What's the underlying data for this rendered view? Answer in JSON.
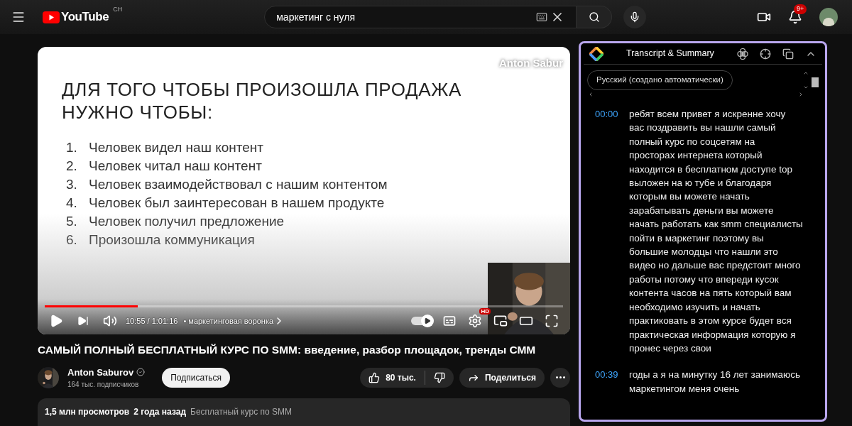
{
  "header": {
    "logo": "YouTube",
    "country": "CH",
    "search": {
      "value": "маркетинг с нуля"
    },
    "notifications": "9+"
  },
  "video": {
    "watermark": "Anton Sabur",
    "slide": {
      "title": "ДЛЯ ТОГО ЧТОБЫ ПРОИЗОШЛА ПРОДАЖА НУЖНО ЧТОБЫ:",
      "items": [
        {
          "number": "1.",
          "text": "Человек видел наш контент"
        },
        {
          "number": "2.",
          "text": "Человек читал наш контент"
        },
        {
          "number": "3.",
          "text": "Человек взаимодействовал с нашим контентом"
        },
        {
          "number": "4.",
          "text": "Человек был заинтересован в нашем продукте"
        },
        {
          "number": "5.",
          "text": "Человек получил предложение"
        },
        {
          "number": "6.",
          "text": "Произошла коммуникация"
        }
      ]
    },
    "progress": {
      "level": 0.18
    },
    "time": "10:55 / 1:01:16",
    "chapter": "• маркетинговая воронка",
    "autoplay": {
      "on": true
    },
    "quality_badge": "HD"
  },
  "title": "САМЫЙ ПОЛНЫЙ БЕСПЛАТНЫЙ КУРС ПО SMM: введение, разбор площадок, тренды СММ",
  "channel": {
    "name": "Anton Saburov",
    "verified": true,
    "subscribers": "164 тыс. подписчиков",
    "subscribe": "Подписаться"
  },
  "actions": {
    "likes": "80 тыс.",
    "share": "Поделиться"
  },
  "description": {
    "views": "1,5 млн просмотров",
    "age": "2 года назад",
    "tag": "Бесплатный курс по SMM"
  },
  "transcript": {
    "title": "Transcript & Summary",
    "language": "Русский (создано автоматически)",
    "entries": [
      {
        "time": "00:00",
        "text": "ребят всем привет я искренне хочу вас поздравить вы нашли самый полный курс по соцсетям на просторах интернета который находится в бесплатном доступе top выложен на ю тубе и благодаря которым вы можете начать зарабатывать деньги вы можете начать работать как smm специалисты пойти в маркетинг поэтому вы большие молодцы что нашли это видео но дальше вас предстоит много работы потому что впереди кусок контента часов на пять который вам необходимо изучить и начать практиковать в этом курсе будет вся практическая информация которую я пронес через свои"
      },
      {
        "time": "00:39",
        "text": "годы а я на минутку 16 лет занимаюсь маркетингом меня очень"
      }
    ]
  }
}
